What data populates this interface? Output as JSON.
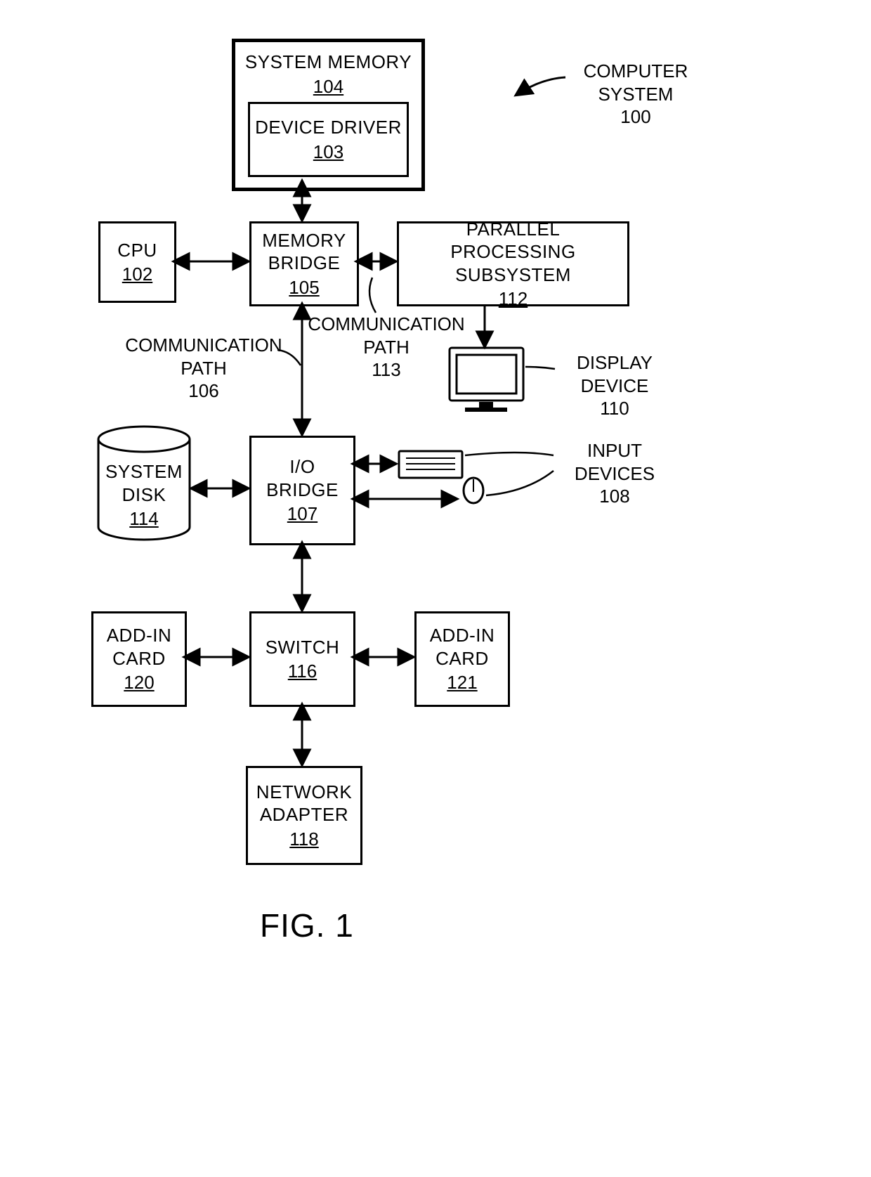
{
  "figure": {
    "label": "FIG. 1"
  },
  "title": {
    "label": "COMPUTER SYSTEM",
    "ref": "100"
  },
  "blocks": {
    "system_memory": {
      "label": "SYSTEM MEMORY",
      "ref": "104"
    },
    "device_driver": {
      "label": "DEVICE DRIVER",
      "ref": "103"
    },
    "cpu": {
      "label": "CPU",
      "ref": "102"
    },
    "memory_bridge": {
      "label": "MEMORY BRIDGE",
      "ref": "105"
    },
    "pps": {
      "label": "PARALLEL PROCESSING SUBSYSTEM",
      "ref": "112"
    },
    "system_disk": {
      "label": "SYSTEM DISK",
      "ref": "114"
    },
    "io_bridge": {
      "label": "I/O BRIDGE",
      "ref": "107"
    },
    "switch": {
      "label": "SWITCH",
      "ref": "116"
    },
    "addin_left": {
      "label": "ADD-IN CARD",
      "ref": "120"
    },
    "addin_right": {
      "label": "ADD-IN CARD",
      "ref": "121"
    },
    "network_adapter": {
      "label": "NETWORK ADAPTER",
      "ref": "118"
    }
  },
  "labels": {
    "comm106": {
      "label": "COMMUNICATION PATH",
      "ref": "106"
    },
    "comm113": {
      "label": "COMMUNICATION PATH",
      "ref": "113"
    },
    "display": {
      "label": "DISPLAY DEVICE",
      "ref": "110"
    },
    "input": {
      "label": "INPUT DEVICES",
      "ref": "108"
    }
  }
}
